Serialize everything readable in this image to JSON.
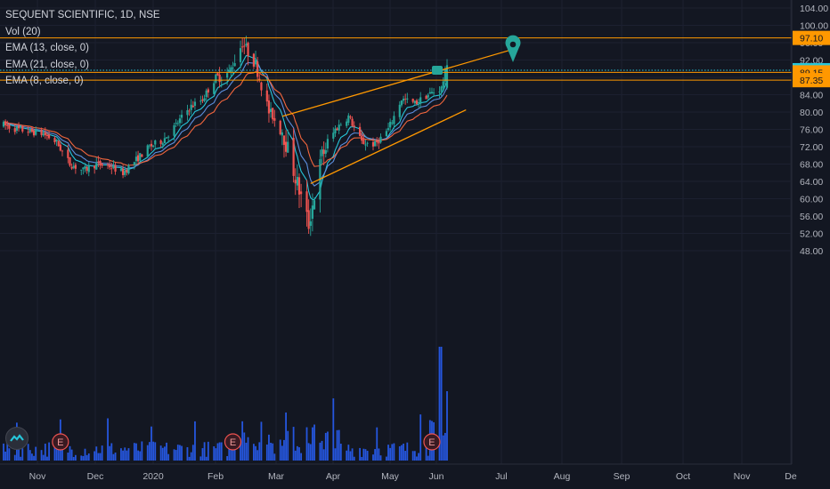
{
  "legend": {
    "symbol": "SEQUENT SCIENTIFIC, 1D, NSE",
    "vol": "Vol (20)",
    "ema13": "EMA (13, close, 0)",
    "ema21": "EMA (21, close, 0)",
    "ema8": "EMA (8, close, 0)"
  },
  "colors": {
    "background": "#131722",
    "up": "#26a69a",
    "down": "#ef5350",
    "volume": "#2962ff",
    "orange": "#ff9800",
    "teal_line": "#26c6da",
    "ema_fast": "#26c6da",
    "ema_mid": "#5c8ddb",
    "ema_slow": "#f2663d",
    "marker": "#26a69a"
  },
  "chart_data": {
    "type": "candlestick",
    "ylim": [
      46.5,
      105
    ],
    "y_ticks": [
      "104.00",
      "100.00",
      "96.00",
      "92.00",
      "88.00",
      "84.00",
      "80.00",
      "76.00",
      "72.00",
      "68.00",
      "64.00",
      "60.00",
      "56.00",
      "52.00",
      "48.00"
    ],
    "x_ticks": [
      "Nov",
      "Dec",
      "2020",
      "Feb",
      "Mar",
      "Apr",
      "May",
      "Jun",
      "Jul",
      "Aug",
      "Sep",
      "Oct",
      "Nov",
      "De"
    ],
    "horizontal_levels": [
      {
        "value": 97.1,
        "label": "97.10",
        "color": "#ff9800"
      },
      {
        "value": 89.65,
        "label": "89.65",
        "color": "#26c6da",
        "style": "dotted"
      },
      {
        "value": 89.15,
        "label": "89.15",
        "color": "#ff9800"
      },
      {
        "value": 87.35,
        "label": "87.35",
        "color": "#ff9800"
      }
    ],
    "trendlines": [
      {
        "from": [
          "2020-03-10",
          79.0
        ],
        "to": [
          "2020-07-10",
          94.5
        ]
      },
      {
        "from": [
          "2020-03-25",
          63.5
        ],
        "to": [
          "2020-06-15",
          80.5
        ]
      }
    ],
    "earnings_markers": [
      "2019-11-14",
      "2020-02-13",
      "2020-05-28"
    ],
    "earnings_label": "E",
    "price_path": [
      {
        "date": "2019-10-15",
        "close": 77.0
      },
      {
        "date": "2019-10-22",
        "close": 76.0
      },
      {
        "date": "2019-10-29",
        "close": 75.5
      },
      {
        "date": "2019-11-05",
        "close": 75.0
      },
      {
        "date": "2019-11-12",
        "close": 73.0
      },
      {
        "date": "2019-11-19",
        "close": 68.0
      },
      {
        "date": "2019-11-26",
        "close": 66.5
      },
      {
        "date": "2019-12-03",
        "close": 68.0
      },
      {
        "date": "2019-12-10",
        "close": 67.5
      },
      {
        "date": "2019-12-17",
        "close": 66.0
      },
      {
        "date": "2019-12-24",
        "close": 69.0
      },
      {
        "date": "2019-12-31",
        "close": 72.0
      },
      {
        "date": "2020-01-07",
        "close": 73.5
      },
      {
        "date": "2020-01-14",
        "close": 77.0
      },
      {
        "date": "2020-01-21",
        "close": 81.0
      },
      {
        "date": "2020-01-28",
        "close": 83.0
      },
      {
        "date": "2020-02-04",
        "close": 88.0
      },
      {
        "date": "2020-02-11",
        "close": 89.0
      },
      {
        "date": "2020-02-18",
        "close": 96.0
      },
      {
        "date": "2020-02-25",
        "close": 91.0
      },
      {
        "date": "2020-03-03",
        "close": 80.0
      },
      {
        "date": "2020-03-10",
        "close": 76.0
      },
      {
        "date": "2020-03-17",
        "close": 65.0
      },
      {
        "date": "2020-03-24",
        "close": 54.0
      },
      {
        "date": "2020-03-31",
        "close": 70.0
      },
      {
        "date": "2020-04-07",
        "close": 76.0
      },
      {
        "date": "2020-04-14",
        "close": 79.0
      },
      {
        "date": "2020-04-21",
        "close": 73.0
      },
      {
        "date": "2020-04-28",
        "close": 72.5
      },
      {
        "date": "2020-05-05",
        "close": 76.0
      },
      {
        "date": "2020-05-12",
        "close": 83.0
      },
      {
        "date": "2020-05-19",
        "close": 82.0
      },
      {
        "date": "2020-05-26",
        "close": 84.0
      },
      {
        "date": "2020-06-02",
        "close": 85.5
      },
      {
        "date": "2020-06-05",
        "close": 91.0
      }
    ],
    "volume_spike_dates": [
      "2020-06-01",
      "2020-06-05"
    ],
    "x_range": [
      "2019-10-15",
      "2020-12-24"
    ]
  }
}
